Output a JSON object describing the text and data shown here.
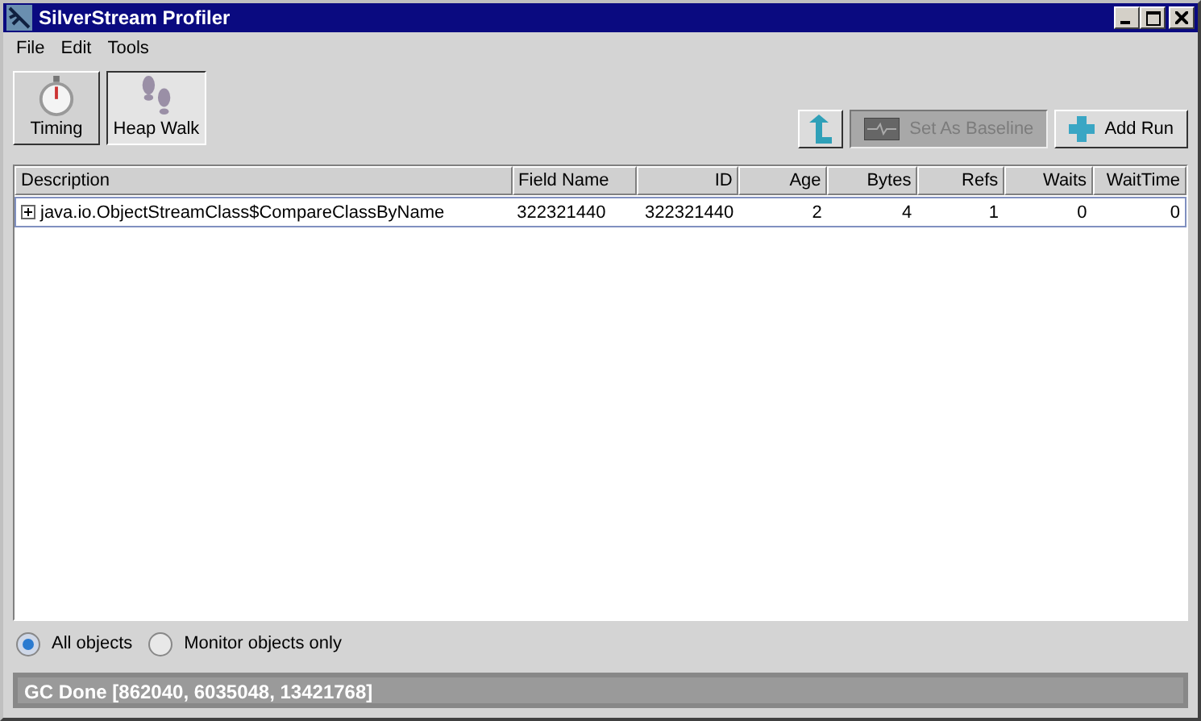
{
  "window": {
    "title": "SilverStream Profiler"
  },
  "menu": [
    "File",
    "Edit",
    "Tools"
  ],
  "tools": [
    {
      "label": "Timing",
      "kind": "timer",
      "selected": false
    },
    {
      "label": "Heap Walk",
      "kind": "footprints",
      "selected": true
    }
  ],
  "actions": [
    {
      "kind": "up",
      "disabled": false
    },
    {
      "kind": "baseline",
      "label": "Set As Baseline",
      "disabled": true
    },
    {
      "kind": "add",
      "label": "Add Run",
      "disabled": false
    }
  ],
  "table": {
    "columns": [
      "Description",
      "Field Name",
      "ID",
      "Age",
      "Bytes",
      "Refs",
      "Waits",
      "WaitTime"
    ],
    "rows": [
      {
        "expanded": false,
        "selected": true,
        "cells": [
          "java.io.ObjectStreamClass$CompareClassByName",
          "322321440",
          "322321440",
          "2",
          "4",
          "1",
          "0",
          "0"
        ]
      }
    ]
  },
  "filters": [
    {
      "label": "All objects",
      "selected": true
    },
    {
      "label": "Monitor objects only",
      "selected": false
    }
  ],
  "status_bar": "GC Done [862040, 6035048, 13421768]"
}
